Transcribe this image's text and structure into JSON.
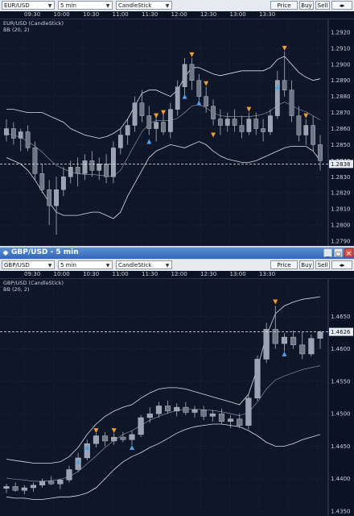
{
  "panel1": {
    "symbol": "EUR/USD",
    "interval": "5 min",
    "chart_type": "CandleStick",
    "buttons": {
      "price_box": "Price Box",
      "buy": "Buy",
      "sell": "Sell"
    },
    "legend": [
      "EUR/USD (CandleStick)",
      "BB (20, 2)"
    ],
    "time_labels": [
      "09:30",
      "10:00",
      "10:30",
      "11:00",
      "11:30",
      "12:00",
      "12:30",
      "13:00",
      "13:30"
    ],
    "price_label": "1.2838",
    "line_color": "#d8dde8",
    "up_color": "#9aa3b3",
    "down_color": "#6f7787",
    "arrow_up_color": "#4aa3e8",
    "arrow_down_color": "#f0a030",
    "chart_data": {
      "type": "candlestick",
      "ylim": [
        1.279,
        1.2925
      ],
      "yticks": [
        "1.2920",
        "1.2910",
        "1.2900",
        "1.2890",
        "1.2880",
        "1.2870",
        "1.2860",
        "1.2850",
        "1.2840",
        "1.2830",
        "1.2820",
        "1.2810",
        "1.2800",
        "1.2790"
      ],
      "current_price": 1.2838,
      "candles": [
        [
          1.2856,
          1.2866,
          1.2852,
          1.286
        ],
        [
          1.286,
          1.2864,
          1.285,
          1.2854
        ],
        [
          1.2854,
          1.286,
          1.2846,
          1.2858
        ],
        [
          1.2858,
          1.2862,
          1.2846,
          1.2848
        ],
        [
          1.2848,
          1.2852,
          1.2828,
          1.2832
        ],
        [
          1.2832,
          1.2838,
          1.282,
          1.2822
        ],
        [
          1.2822,
          1.2828,
          1.28,
          1.2812
        ],
        [
          1.2812,
          1.283,
          1.2794,
          1.2822
        ],
        [
          1.2822,
          1.2836,
          1.2818,
          1.283
        ],
        [
          1.283,
          1.284,
          1.2826,
          1.2836
        ],
        [
          1.2836,
          1.2842,
          1.2824,
          1.2832
        ],
        [
          1.2832,
          1.2844,
          1.2828,
          1.284
        ],
        [
          1.284,
          1.2846,
          1.283,
          1.2834
        ],
        [
          1.2834,
          1.2842,
          1.2828,
          1.2838
        ],
        [
          1.2838,
          1.2844,
          1.2826,
          1.283
        ],
        [
          1.283,
          1.2852,
          1.2826,
          1.2848
        ],
        [
          1.2848,
          1.286,
          1.2844,
          1.2856
        ],
        [
          1.2856,
          1.2866,
          1.285,
          1.2862
        ],
        [
          1.2862,
          1.288,
          1.2858,
          1.2876
        ],
        [
          1.2876,
          1.2884,
          1.2864,
          1.2868
        ],
        [
          1.2868,
          1.2874,
          1.2856,
          1.286
        ],
        [
          1.286,
          1.2868,
          1.2852,
          1.2864
        ],
        [
          1.2864,
          1.287,
          1.2856,
          1.2858
        ],
        [
          1.2858,
          1.2876,
          1.2854,
          1.2872
        ],
        [
          1.2872,
          1.289,
          1.2868,
          1.2886
        ],
        [
          1.2886,
          1.2904,
          1.288,
          1.29
        ],
        [
          1.29,
          1.2904,
          1.2884,
          1.289
        ],
        [
          1.289,
          1.2894,
          1.2876,
          1.288
        ],
        [
          1.288,
          1.2886,
          1.287,
          1.2874
        ],
        [
          1.2874,
          1.2878,
          1.2862,
          1.2866
        ],
        [
          1.2866,
          1.2872,
          1.2856,
          1.2862
        ],
        [
          1.2862,
          1.287,
          1.2858,
          1.2866
        ],
        [
          1.2866,
          1.2872,
          1.2858,
          1.2862
        ],
        [
          1.2862,
          1.2868,
          1.2854,
          1.2858
        ],
        [
          1.2858,
          1.287,
          1.2856,
          1.2866
        ],
        [
          1.2866,
          1.287,
          1.2856,
          1.286
        ],
        [
          1.286,
          1.2866,
          1.2852,
          1.2858
        ],
        [
          1.2858,
          1.2872,
          1.2856,
          1.2868
        ],
        [
          1.2868,
          1.2896,
          1.2866,
          1.289
        ],
        [
          1.289,
          1.2908,
          1.288,
          1.2884
        ],
        [
          1.2884,
          1.289,
          1.2864,
          1.2868
        ],
        [
          1.2868,
          1.2874,
          1.2852,
          1.2856
        ],
        [
          1.2856,
          1.2866,
          1.285,
          1.2862
        ],
        [
          1.2862,
          1.2868,
          1.2846,
          1.285
        ],
        [
          1.285,
          1.2856,
          1.2834,
          1.284
        ]
      ],
      "bb_upper": [
        1.2872,
        1.2872,
        1.2871,
        1.287,
        1.287,
        1.287,
        1.2868,
        1.2866,
        1.2864,
        1.286,
        1.2858,
        1.2856,
        1.2855,
        1.2854,
        1.2855,
        1.2857,
        1.286,
        1.2866,
        1.2874,
        1.2882,
        1.2884,
        1.2884,
        1.2882,
        1.288,
        1.2884,
        1.2892,
        1.2898,
        1.2898,
        1.2896,
        1.2894,
        1.2893,
        1.2894,
        1.2895,
        1.2896,
        1.2896,
        1.2896,
        1.2896,
        1.2898,
        1.2903,
        1.2905,
        1.29,
        1.2895,
        1.2892,
        1.289,
        1.2891
      ],
      "bb_lower": [
        1.2842,
        1.284,
        1.2838,
        1.2834,
        1.2828,
        1.2821,
        1.2814,
        1.2808,
        1.2806,
        1.2806,
        1.2806,
        1.2807,
        1.2808,
        1.2808,
        1.2806,
        1.2804,
        1.2808,
        1.2818,
        1.2826,
        1.2834,
        1.2842,
        1.2846,
        1.2848,
        1.285,
        1.2849,
        1.2848,
        1.285,
        1.2852,
        1.285,
        1.2846,
        1.2843,
        1.2841,
        1.284,
        1.2839,
        1.2839,
        1.284,
        1.2842,
        1.2844,
        1.2846,
        1.2848,
        1.2849,
        1.2849,
        1.2849,
        1.2846,
        1.284
      ],
      "signals": [
        {
          "i": 20,
          "type": "up",
          "price": 1.2852
        },
        {
          "i": 21,
          "type": "down",
          "price": 1.2868
        },
        {
          "i": 22,
          "type": "down",
          "price": 1.287
        },
        {
          "i": 25,
          "type": "up",
          "price": 1.288
        },
        {
          "i": 26,
          "type": "down",
          "price": 1.2906
        },
        {
          "i": 27,
          "type": "up",
          "price": 1.2876
        },
        {
          "i": 28,
          "type": "down",
          "price": 1.2888
        },
        {
          "i": 29,
          "type": "down",
          "price": 1.2856
        },
        {
          "i": 34,
          "type": "down",
          "price": 1.2872
        },
        {
          "i": 38,
          "type": "up",
          "price": 1.2886
        },
        {
          "i": 39,
          "type": "down",
          "price": 1.291
        },
        {
          "i": 42,
          "type": "down",
          "price": 1.2868
        }
      ]
    }
  },
  "panel2": {
    "title": "GBP/USD - 5 min",
    "symbol": "GBP/USD",
    "interval": "5 min",
    "chart_type": "CandleStick",
    "buttons": {
      "price_box": "Price Box",
      "buy": "Buy",
      "sell": "Sell"
    },
    "window_buttons": {
      "minimize": "_",
      "restore": "▢",
      "close": "✕"
    },
    "legend": [
      "GBP/USD (CandleStick)",
      "BB (20, 2)"
    ],
    "time_labels": [
      "09:30",
      "10:00",
      "10:30",
      "11:00",
      "11:30",
      "12:00",
      "12:30",
      "13:00",
      "13:30"
    ],
    "price_label": "1.4626",
    "line_color": "#d8dde8",
    "up_color": "#9aa3b3",
    "down_color": "#6f7787",
    "arrow_up_color": "#4aa3e8",
    "arrow_down_color": "#f0a030",
    "chart_data": {
      "type": "candlestick",
      "ylim": [
        1.435,
        1.47
      ],
      "yticks": [
        "1.4650",
        "1.4600",
        "1.4550",
        "1.4500",
        "1.4450",
        "1.4400",
        "1.4350"
      ],
      "current_price": 1.4626,
      "candles": [
        [
          1.4385,
          1.4392,
          1.4378,
          1.4388
        ],
        [
          1.4388,
          1.4394,
          1.438,
          1.4382
        ],
        [
          1.4382,
          1.439,
          1.4376,
          1.4386
        ],
        [
          1.4386,
          1.4394,
          1.438,
          1.439
        ],
        [
          1.439,
          1.44,
          1.4386,
          1.4396
        ],
        [
          1.4396,
          1.4404,
          1.439,
          1.4392
        ],
        [
          1.4392,
          1.44,
          1.4384,
          1.4398
        ],
        [
          1.4398,
          1.442,
          1.4394,
          1.4414
        ],
        [
          1.4414,
          1.444,
          1.441,
          1.4432
        ],
        [
          1.4432,
          1.446,
          1.4428,
          1.4454
        ],
        [
          1.4454,
          1.447,
          1.4448,
          1.4466
        ],
        [
          1.4466,
          1.4472,
          1.445,
          1.4458
        ],
        [
          1.4458,
          1.447,
          1.4452,
          1.4464
        ],
        [
          1.4464,
          1.4472,
          1.4456,
          1.446
        ],
        [
          1.446,
          1.4474,
          1.4452,
          1.4468
        ],
        [
          1.4468,
          1.4498,
          1.4464,
          1.4494
        ],
        [
          1.4494,
          1.451,
          1.4486,
          1.45
        ],
        [
          1.45,
          1.4518,
          1.4494,
          1.4512
        ],
        [
          1.4512,
          1.452,
          1.45,
          1.4504
        ],
        [
          1.4504,
          1.4516,
          1.4496,
          1.451
        ],
        [
          1.451,
          1.4518,
          1.4498,
          1.4502
        ],
        [
          1.4502,
          1.4512,
          1.4494,
          1.4506
        ],
        [
          1.4506,
          1.4512,
          1.449,
          1.4496
        ],
        [
          1.4496,
          1.4506,
          1.4488,
          1.45
        ],
        [
          1.45,
          1.4508,
          1.4484,
          1.4488
        ],
        [
          1.4488,
          1.4498,
          1.4478,
          1.4492
        ],
        [
          1.4492,
          1.45,
          1.4478,
          1.4482
        ],
        [
          1.4482,
          1.453,
          1.4476,
          1.4524
        ],
        [
          1.4524,
          1.459,
          1.452,
          1.4584
        ],
        [
          1.4584,
          1.464,
          1.4578,
          1.463
        ],
        [
          1.463,
          1.4666,
          1.46,
          1.4608
        ],
        [
          1.4608,
          1.4624,
          1.4596,
          1.4618
        ],
        [
          1.4618,
          1.4628,
          1.46,
          1.4606
        ],
        [
          1.4606,
          1.4626,
          1.4584,
          1.4592
        ],
        [
          1.4592,
          1.4622,
          1.4588,
          1.4616
        ],
        [
          1.4616,
          1.4628,
          1.46,
          1.4626
        ]
      ],
      "bb_upper": [
        1.443,
        1.4428,
        1.4426,
        1.4424,
        1.4424,
        1.4424,
        1.4426,
        1.4434,
        1.4448,
        1.4468,
        1.4484,
        1.4496,
        1.4504,
        1.451,
        1.4514,
        1.4524,
        1.4532,
        1.4538,
        1.454,
        1.454,
        1.4538,
        1.4534,
        1.453,
        1.4526,
        1.4522,
        1.4518,
        1.4514,
        1.453,
        1.457,
        1.462,
        1.4654,
        1.4666,
        1.4672,
        1.4676,
        1.4678,
        1.468
      ],
      "bb_lower": [
        1.4372,
        1.437,
        1.437,
        1.4368,
        1.4368,
        1.437,
        1.4372,
        1.4372,
        1.4374,
        1.4378,
        1.4386,
        1.44,
        1.4414,
        1.4426,
        1.4434,
        1.444,
        1.4448,
        1.4454,
        1.4462,
        1.447,
        1.4476,
        1.448,
        1.4482,
        1.4484,
        1.4484,
        1.4482,
        1.448,
        1.4474,
        1.4466,
        1.4456,
        1.445,
        1.445,
        1.4454,
        1.446,
        1.4464,
        1.4468
      ],
      "signals": [
        {
          "i": 8,
          "type": "up",
          "price": 1.4426
        },
        {
          "i": 9,
          "type": "up",
          "price": 1.4448
        },
        {
          "i": 10,
          "type": "down",
          "price": 1.4474
        },
        {
          "i": 12,
          "type": "down",
          "price": 1.4474
        },
        {
          "i": 14,
          "type": "up",
          "price": 1.4448
        },
        {
          "i": 30,
          "type": "down",
          "price": 1.4672
        },
        {
          "i": 31,
          "type": "up",
          "price": 1.4592
        }
      ]
    }
  }
}
